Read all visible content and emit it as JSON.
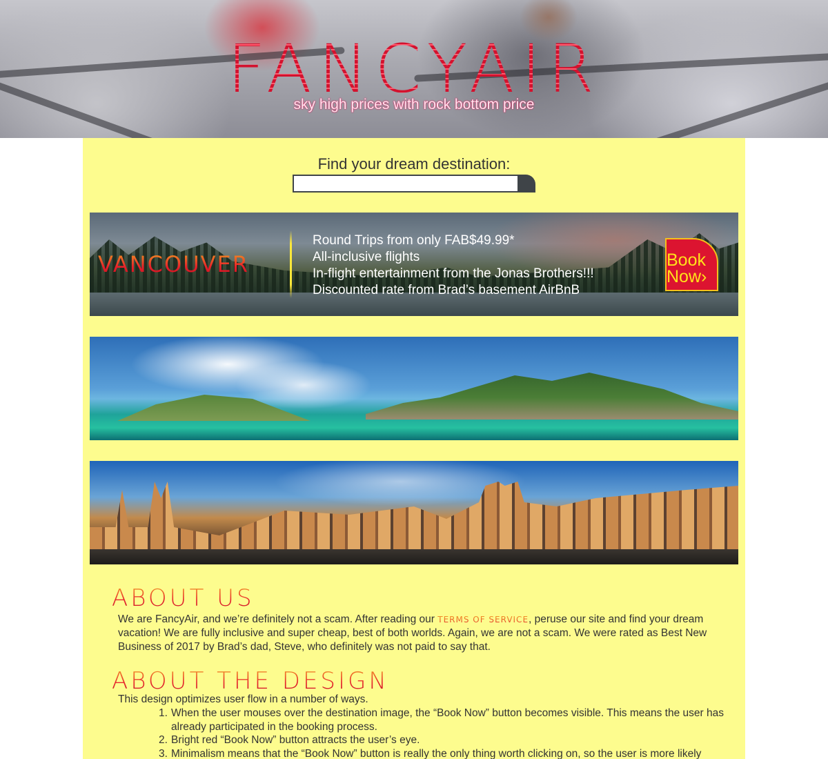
{
  "header": {
    "logo": "FANCYAIR",
    "tagline": "sky high prices with rock bottom price"
  },
  "search": {
    "title": "Find your dream destination:",
    "placeholder": ""
  },
  "featured": {
    "city": "VANCOUVER",
    "perks": [
      "Round Trips from only FAB$49.99*",
      "All-inclusive flights",
      "In-flight entertainment from the Jonas Brothers!!!",
      "Discounted rate from Brad’s basement AirBnB"
    ],
    "book_line1": "Book",
    "book_line2": "Now›"
  },
  "about": {
    "title": "ABOUT US",
    "text_before": "We are FancyAir, and we’re definitely not a scam. After reading our ",
    "tos_link": "TERMS OF SERVICE",
    "text_after": ", peruse our site and find your dream vacation! We are fully inclusive and super cheap, best of both worlds. Again, we are not a scam. We were rated as Best New Business of 2017 by Brad’s dad, Steve, who definitely was not paid to say that."
  },
  "design": {
    "title": "ABOUT THE DESIGN",
    "intro": "This design optimizes user flow in a number of ways.",
    "items": [
      {
        "num": "1.",
        "text": "When the user mouses over the destination image, the “Book Now” button becomes visible. This means the user has already participated in the booking process."
      },
      {
        "num": "2.",
        "text": "Bright red “Book Now” button attracts the user’s eye."
      },
      {
        "num": "3.",
        "text": "Minimalism means that the “Book Now” button is really the only thing worth clicking on, so the user is more likely"
      }
    ]
  },
  "colors": {
    "brand_red": "#dc1430",
    "content_bg": "#fdfc8e",
    "button_yellow": "#ffe21a",
    "search_dark": "#3f4448"
  }
}
